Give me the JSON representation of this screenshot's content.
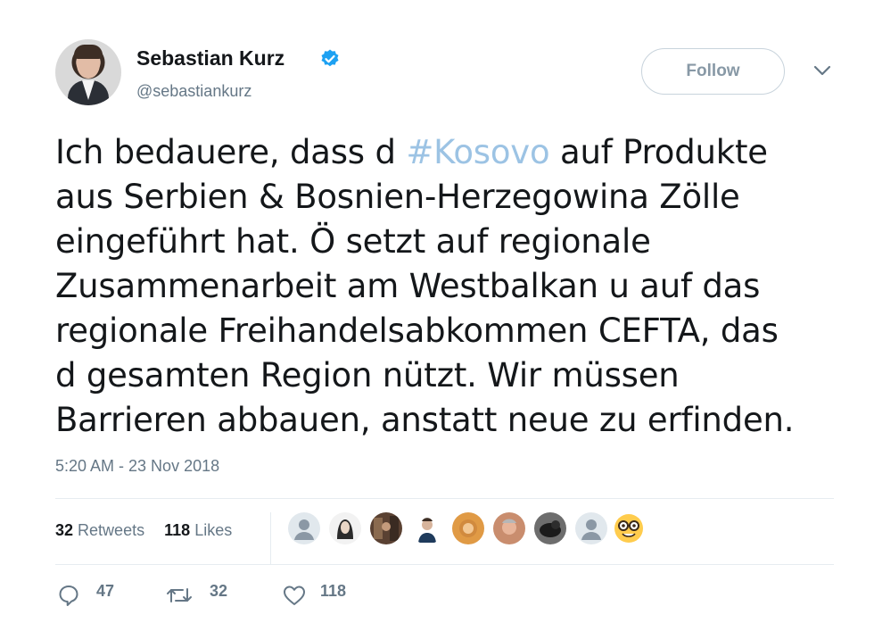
{
  "author": {
    "name": "Sebastian Kurz",
    "handle": "@sebastiankurz",
    "verified": true
  },
  "follow_label": "Follow",
  "tweet": {
    "lines": [
      {
        "pre": "Ich bedauere, dass d ",
        "hashtag": "#Kosovo",
        "post": " auf Produkte"
      },
      {
        "text": "aus Serbien & Bosnien-Herzegowina Zölle"
      },
      {
        "text": "eingeführt hat. Ö setzt auf regionale"
      },
      {
        "text": "Zusammenarbeit am Westbalkan u auf das"
      },
      {
        "text": "regionale Freihandelsabkommen CEFTA, das"
      },
      {
        "text": "d gesamten Region nützt. Wir müssen"
      },
      {
        "text": "Barrieren abbauen, anstatt neue zu erfinden."
      }
    ]
  },
  "timestamp": "5:20 AM - 23 Nov 2018",
  "stats": {
    "retweets_count": "32",
    "retweets_label": "Retweets",
    "likes_count": "118",
    "likes_label": "Likes"
  },
  "likers": [
    {
      "icon": "default-avatar-icon"
    },
    {
      "icon": "user-avatar-icon"
    },
    {
      "icon": "user-avatar-icon"
    },
    {
      "icon": "user-avatar-icon"
    },
    {
      "icon": "user-avatar-icon"
    },
    {
      "icon": "user-avatar-icon"
    },
    {
      "icon": "user-avatar-icon"
    },
    {
      "icon": "default-avatar-icon"
    },
    {
      "icon": "nerd-face-emoji-icon"
    }
  ],
  "actions": {
    "reply_count": "47",
    "retweet_count": "32",
    "like_count": "118"
  },
  "colors": {
    "hashtag": "#9cc3e4",
    "verified": "#1da1f2",
    "muted": "#657786",
    "text": "#14171a"
  }
}
